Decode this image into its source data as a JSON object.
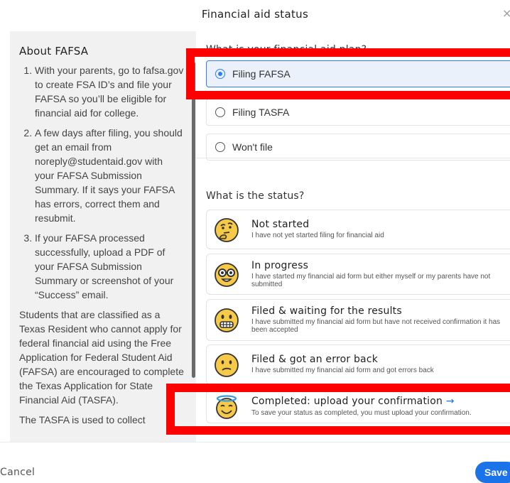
{
  "dialog": {
    "title": "Financial aid status",
    "close_glyph": "×"
  },
  "about": {
    "title": "About FAFSA",
    "steps": [
      "With your parents, go to fafsa.gov to create FSA ID’s and file your FAFSA so you’ll be eligible for financial aid for college.",
      "A few days after filing, you should get an email from noreply@studentaid.gov with your FAFSA Submission Summary. If it says your FAFSA has errors, correct them and resubmit.",
      "If your FAFSA processed successfully, upload a PDF of your FAFSA Submission Summary or screenshot of your “Success” email."
    ],
    "paragraphs": [
      "Students that are classified as a Texas Resident who cannot apply for federal financial aid using the Free Application for Federal Student Aid (FAFSA) are encouraged to complete the Texas Application for State Financial Aid (TASFA).",
      "The TASFA is used to collect"
    ]
  },
  "plan": {
    "question": "What is your financial aid plan?",
    "options": [
      {
        "label": "Filing FAFSA",
        "selected": true
      },
      {
        "label": "Filing TASFA",
        "selected": false
      },
      {
        "label": "Won't file",
        "selected": false
      }
    ]
  },
  "status": {
    "question": "What is the status?",
    "items": [
      {
        "title": "Not started",
        "desc": "I have not yet started filing for financial aid",
        "icon": "thinking-face-icon"
      },
      {
        "title": "In progress",
        "desc": "I have started my financial aid form but either myself or my parents have not submitted",
        "icon": "nerd-face-icon"
      },
      {
        "title": "Filed & waiting for the results",
        "desc": "I have submitted my financial aid form but have not received confirmation it has been accepted",
        "icon": "grimacing-face-icon"
      },
      {
        "title": "Filed & got an error back",
        "desc": "I have submitted my financial aid form and got errors back",
        "icon": "confused-face-icon"
      },
      {
        "title": "Completed: upload your confirmation",
        "arrow": "→",
        "desc": "To save your status as completed, you must upload your confirmation.",
        "icon": "halo-face-icon"
      }
    ]
  },
  "footer": {
    "cancel_label": "Cancel",
    "save_label": "Save"
  },
  "colors": {
    "accent": "#1a73e8",
    "highlight": "#ff0000",
    "emoji_yellow": "#f7c948"
  }
}
